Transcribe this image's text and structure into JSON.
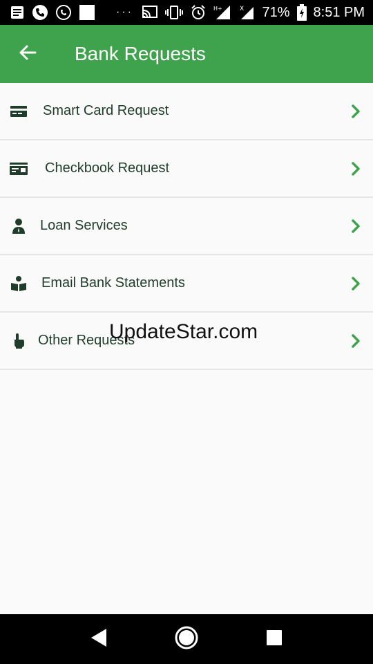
{
  "status_bar": {
    "battery": "71%",
    "time": "8:51 PM",
    "dots": "···"
  },
  "app_bar": {
    "title": "Bank Requests"
  },
  "menu": {
    "items": [
      {
        "label": "Smart Card Request",
        "icon": "card-icon"
      },
      {
        "label": "Checkbook Request",
        "icon": "checkbook-icon"
      },
      {
        "label": "Loan Services",
        "icon": "person-icon"
      },
      {
        "label": "Email Bank Statements",
        "icon": "book-reader-icon"
      },
      {
        "label": "Other Requests",
        "icon": "hand-pointer-icon"
      }
    ]
  },
  "watermark": "UpdateStar.com",
  "colors": {
    "app_bar": "#3fa34d",
    "chevron": "#3fa34d",
    "icon": "#1f3d2a",
    "background": "#fafafa"
  }
}
